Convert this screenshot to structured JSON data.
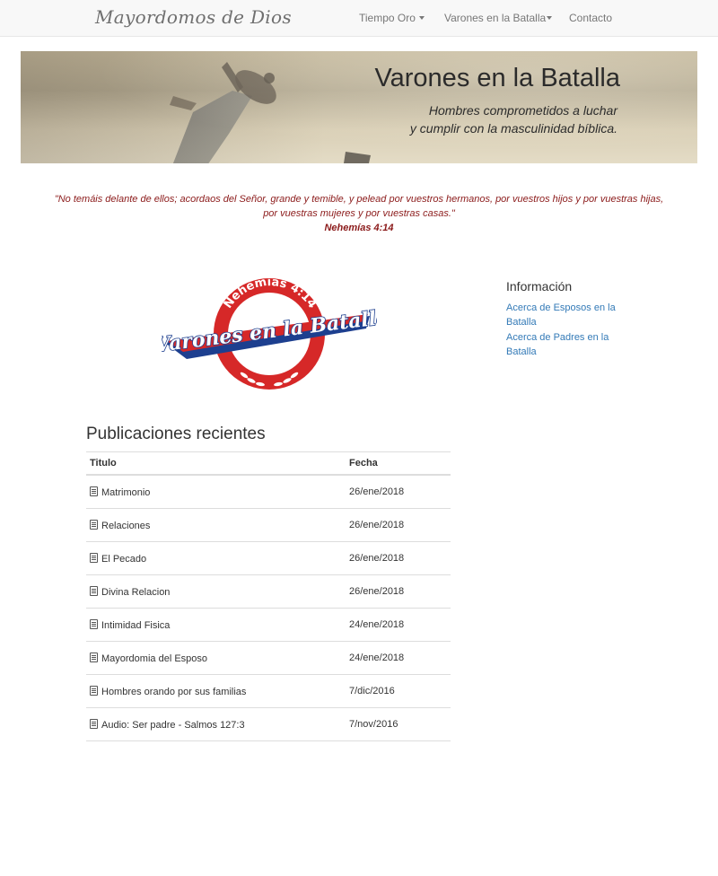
{
  "navbar": {
    "brand": "Mayordomos de Dios",
    "items": [
      {
        "label": "Tiempo Oro",
        "dropdown": true
      },
      {
        "label": "Varones en la Batalla",
        "dropdown": true
      },
      {
        "label": "Contacto",
        "dropdown": false
      }
    ]
  },
  "banner": {
    "title": "Varones en la Batalla",
    "subtitle_line1": "Hombres comprometidos a luchar",
    "subtitle_line2": "y cumplir con la masculinidad bíblica."
  },
  "quote": {
    "line1": "\"No temáis delante de ellos; acordaos del Señor, grande y temible, y pelead por vuestros hermanos, por vuestros hijos y por vuestras hijas,",
    "line2": "por vuestras mujeres y por vuestras casas.\"",
    "reference": "Nehemías 4:14"
  },
  "logo": {
    "top_text": "Nehemias 4:14",
    "main_text": "Varones en la Batalla",
    "red": "#d62828",
    "blue": "#1d3f8f"
  },
  "sidebar": {
    "title": "Información",
    "links": [
      "Acerca de Esposos en la Batalla",
      "Acerca de Padres en la Batalla"
    ]
  },
  "recent": {
    "title": "Publicaciones recientes",
    "columns": [
      "Titulo",
      "Fecha"
    ],
    "rows": [
      {
        "title": "Matrimonio",
        "date": "26/ene/2018"
      },
      {
        "title": "Relaciones",
        "date": "26/ene/2018"
      },
      {
        "title": "El Pecado",
        "date": "26/ene/2018"
      },
      {
        "title": "Divina Relacion",
        "date": "26/ene/2018"
      },
      {
        "title": "Intimidad Fisica",
        "date": "24/ene/2018"
      },
      {
        "title": "Mayordomia del Esposo",
        "date": "24/ene/2018"
      },
      {
        "title": "Hombres orando por sus familias",
        "date": "7/dic/2016"
      },
      {
        "title": "Audio: Ser padre - Salmos 127:3",
        "date": "7/nov/2016"
      }
    ]
  },
  "colors": {
    "link": "#337ab7",
    "quote": "#8b1a1a",
    "navbar_bg": "#f8f8f8"
  }
}
